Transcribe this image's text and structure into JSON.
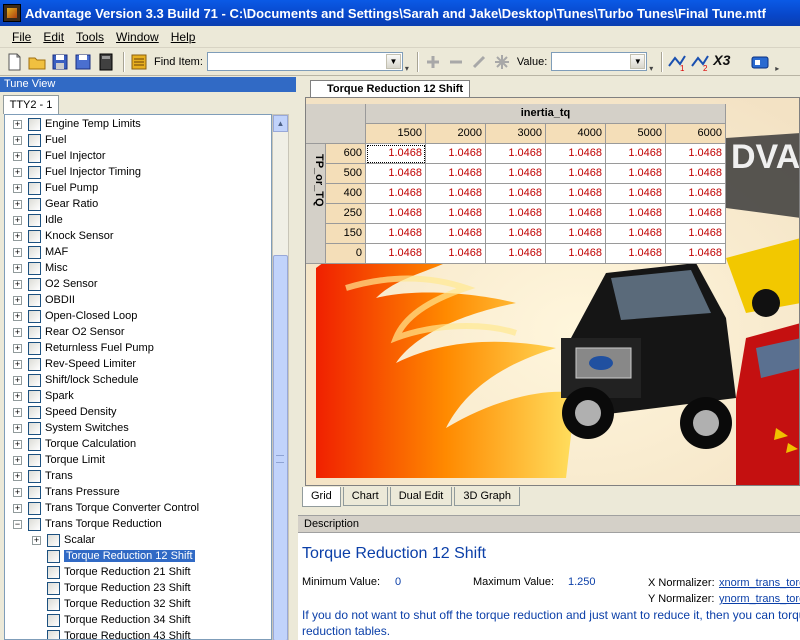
{
  "window": {
    "title": "Advantage Version 3.3 Build 71 - C:\\Documents and Settings\\Sarah and Jake\\Desktop\\Tunes\\Turbo Tunes\\Final Tune.mtf"
  },
  "menu": [
    "File",
    "Edit",
    "Tools",
    "Window",
    "Help"
  ],
  "toolbar": {
    "find_label": "Find Item:",
    "find_value": "",
    "value_label": "Value:",
    "value_value": "",
    "x3_label": "X3"
  },
  "tune_view": {
    "header": "Tune View",
    "tab": "TTY2 - 1",
    "items": [
      {
        "label": "Engine Temp Limits",
        "level": 0,
        "expander": "+"
      },
      {
        "label": "Fuel",
        "level": 0,
        "expander": "+"
      },
      {
        "label": "Fuel Injector",
        "level": 0,
        "expander": "+"
      },
      {
        "label": "Fuel Injector Timing",
        "level": 0,
        "expander": "+"
      },
      {
        "label": "Fuel Pump",
        "level": 0,
        "expander": "+"
      },
      {
        "label": "Gear Ratio",
        "level": 0,
        "expander": "+"
      },
      {
        "label": "Idle",
        "level": 0,
        "expander": "+"
      },
      {
        "label": "Knock Sensor",
        "level": 0,
        "expander": "+"
      },
      {
        "label": "MAF",
        "level": 0,
        "expander": "+"
      },
      {
        "label": "Misc",
        "level": 0,
        "expander": "+"
      },
      {
        "label": "O2 Sensor",
        "level": 0,
        "expander": "+"
      },
      {
        "label": "OBDII",
        "level": 0,
        "expander": "+"
      },
      {
        "label": "Open-Closed Loop",
        "level": 0,
        "expander": "+"
      },
      {
        "label": "Rear O2 Sensor",
        "level": 0,
        "expander": "+"
      },
      {
        "label": "Returnless Fuel Pump",
        "level": 0,
        "expander": "+"
      },
      {
        "label": "Rev-Speed Limiter",
        "level": 0,
        "expander": "+"
      },
      {
        "label": "Shift/lock Schedule",
        "level": 0,
        "expander": "+"
      },
      {
        "label": "Spark",
        "level": 0,
        "expander": "+"
      },
      {
        "label": "Speed Density",
        "level": 0,
        "expander": "+"
      },
      {
        "label": "System Switches",
        "level": 0,
        "expander": "+"
      },
      {
        "label": "Torque Calculation",
        "level": 0,
        "expander": "+"
      },
      {
        "label": "Torque Limit",
        "level": 0,
        "expander": "+"
      },
      {
        "label": "Trans",
        "level": 0,
        "expander": "+"
      },
      {
        "label": "Trans Pressure",
        "level": 0,
        "expander": "+"
      },
      {
        "label": "Trans Torque Converter Control",
        "level": 0,
        "expander": "+"
      },
      {
        "label": "Trans Torque Reduction",
        "level": 0,
        "expander": "-"
      },
      {
        "label": "Scalar",
        "level": 1,
        "expander": "+"
      },
      {
        "label": "Torque Reduction 12 Shift",
        "level": 1,
        "expander": "",
        "selected": true
      },
      {
        "label": "Torque Reduction 21 Shift",
        "level": 1,
        "expander": ""
      },
      {
        "label": "Torque Reduction 23 Shift",
        "level": 1,
        "expander": ""
      },
      {
        "label": "Torque Reduction 32 Shift",
        "level": 1,
        "expander": ""
      },
      {
        "label": "Torque Reduction 34 Shift",
        "level": 1,
        "expander": ""
      },
      {
        "label": "Torque Reduction 43 Shift",
        "level": 1,
        "expander": ""
      }
    ]
  },
  "document": {
    "tab": "Torque Reduction 12 Shift",
    "table": {
      "col_axis_label": "inertia_tq",
      "row_axis_label": "TP_or_TQ",
      "columns": [
        "1500",
        "2000",
        "3000",
        "4000",
        "5000",
        "6000"
      ],
      "rows": [
        {
          "label": "600",
          "values": [
            "1.0468",
            "1.0468",
            "1.0468",
            "1.0468",
            "1.0468",
            "1.0468"
          ]
        },
        {
          "label": "500",
          "values": [
            "1.0468",
            "1.0468",
            "1.0468",
            "1.0468",
            "1.0468",
            "1.0468"
          ]
        },
        {
          "label": "400",
          "values": [
            "1.0468",
            "1.0468",
            "1.0468",
            "1.0468",
            "1.0468",
            "1.0468"
          ]
        },
        {
          "label": "250",
          "values": [
            "1.0468",
            "1.0468",
            "1.0468",
            "1.0468",
            "1.0468",
            "1.0468"
          ]
        },
        {
          "label": "150",
          "values": [
            "1.0468",
            "1.0468",
            "1.0468",
            "1.0468",
            "1.0468",
            "1.0468"
          ]
        },
        {
          "label": "0",
          "values": [
            "1.0468",
            "1.0468",
            "1.0468",
            "1.0468",
            "1.0468",
            "1.0468"
          ]
        }
      ]
    },
    "view_tabs": [
      "Grid",
      "Chart",
      "Dual Edit",
      "3D Graph"
    ],
    "active_view_tab": "Grid",
    "background_text": "DVA"
  },
  "description": {
    "header": "Description",
    "title": "Torque Reduction 12 Shift",
    "min_label": "Minimum Value:",
    "min_value": "0",
    "max_label": "Maximum Value:",
    "max_value": "1.250",
    "x_norm_label": "X Normalizer:",
    "x_norm_value": "xnorm_trans_torq",
    "y_norm_label": "Y Normalizer:",
    "y_norm_value": "ynorm_trans_torq",
    "text": "If you do not want to shut off the torque reduction and just want to reduce it, then you can torque reduction tables."
  }
}
